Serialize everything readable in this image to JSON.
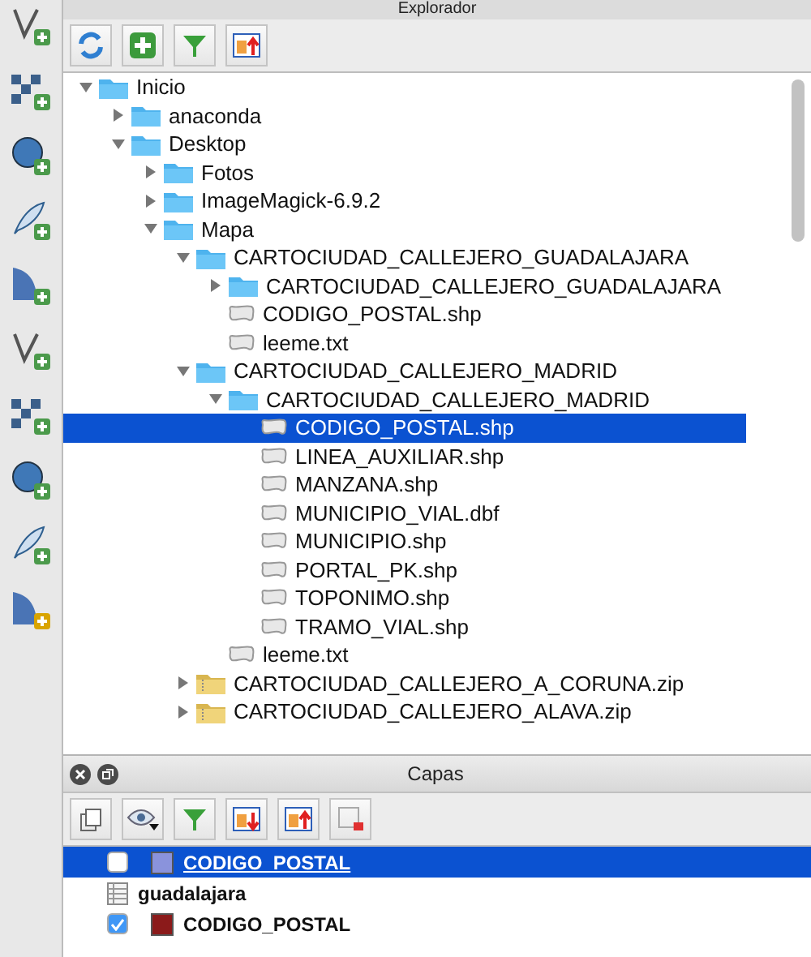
{
  "explorer": {
    "title": "Explorador",
    "tree": [
      {
        "label": "Inicio",
        "kind": "folder",
        "expanded": true,
        "selected": false,
        "children": [
          {
            "label": "anaconda",
            "kind": "folder",
            "expanded": false,
            "selected": false
          },
          {
            "label": "Desktop",
            "kind": "folder",
            "expanded": true,
            "selected": false,
            "children": [
              {
                "label": "Fotos",
                "kind": "folder",
                "expanded": false,
                "selected": false
              },
              {
                "label": "ImageMagick-6.9.2",
                "kind": "folder",
                "expanded": false,
                "selected": false
              },
              {
                "label": "Mapa",
                "kind": "folder",
                "expanded": true,
                "selected": false,
                "children": [
                  {
                    "label": "CARTOCIUDAD_CALLEJERO_GUADALAJARA",
                    "kind": "folder",
                    "expanded": true,
                    "selected": false,
                    "children": [
                      {
                        "label": "CARTOCIUDAD_CALLEJERO_GUADALAJARA",
                        "kind": "folder",
                        "expanded": false,
                        "selected": false
                      },
                      {
                        "label": "CODIGO_POSTAL.shp",
                        "kind": "file",
                        "selected": false
                      },
                      {
                        "label": "leeme.txt",
                        "kind": "file",
                        "selected": false
                      }
                    ]
                  },
                  {
                    "label": "CARTOCIUDAD_CALLEJERO_MADRID",
                    "kind": "folder",
                    "expanded": true,
                    "selected": false,
                    "children": [
                      {
                        "label": "CARTOCIUDAD_CALLEJERO_MADRID",
                        "kind": "folder",
                        "expanded": true,
                        "selected": false,
                        "children": [
                          {
                            "label": "CODIGO_POSTAL.shp",
                            "kind": "file",
                            "selected": true
                          },
                          {
                            "label": "LINEA_AUXILIAR.shp",
                            "kind": "file",
                            "selected": false
                          },
                          {
                            "label": "MANZANA.shp",
                            "kind": "file",
                            "selected": false
                          },
                          {
                            "label": "MUNICIPIO_VIAL.dbf",
                            "kind": "file",
                            "selected": false
                          },
                          {
                            "label": "MUNICIPIO.shp",
                            "kind": "file",
                            "selected": false
                          },
                          {
                            "label": "PORTAL_PK.shp",
                            "kind": "file",
                            "selected": false
                          },
                          {
                            "label": "TOPONIMO.shp",
                            "kind": "file",
                            "selected": false
                          },
                          {
                            "label": "TRAMO_VIAL.shp",
                            "kind": "file",
                            "selected": false
                          }
                        ]
                      },
                      {
                        "label": "leeme.txt",
                        "kind": "file",
                        "selected": false
                      }
                    ]
                  },
                  {
                    "label": "CARTOCIUDAD_CALLEJERO_A_CORUNA.zip",
                    "kind": "archive",
                    "expanded": false,
                    "selected": false
                  },
                  {
                    "label": "CARTOCIUDAD_CALLEJERO_ALAVA.zip",
                    "kind": "archive",
                    "expanded": false,
                    "selected": false
                  }
                ]
              }
            ]
          }
        ]
      }
    ]
  },
  "layers": {
    "title": "Capas",
    "items": [
      {
        "label": "CODIGO_POSTAL",
        "kind": "layer",
        "checked": false,
        "color": "#8a93dc",
        "selected": true
      },
      {
        "label": "guadalajara",
        "kind": "group",
        "selected": false
      },
      {
        "label": "CODIGO_POSTAL",
        "kind": "layer",
        "checked": true,
        "color": "#8b1a1a",
        "selected": false
      }
    ]
  }
}
